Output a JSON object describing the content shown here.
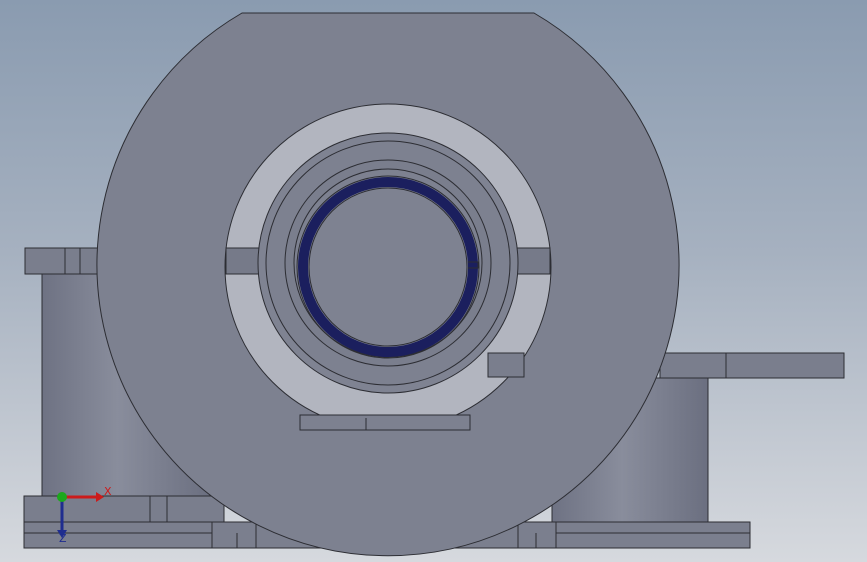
{
  "app": {
    "view": "front-orthographic",
    "colors": {
      "background_top": "#8a9bb0",
      "background_bottom": "#d6d9de",
      "part_face": "#7d8190",
      "part_edge": "#2c2d33",
      "seal_ring": "#1b1f5e",
      "x_axis": "#cc1b1b",
      "y_axis": "#1ca81c",
      "z_axis": "#1f2d8f"
    }
  },
  "triad": {
    "x_label": "X",
    "z_label": "Z"
  }
}
